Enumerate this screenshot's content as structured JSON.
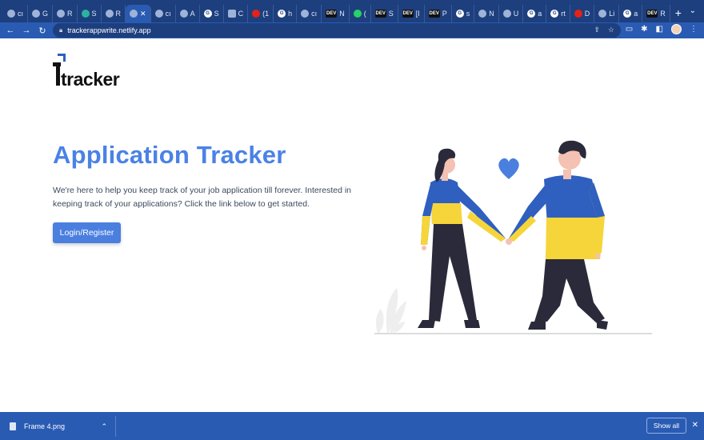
{
  "browser": {
    "tabs": [
      {
        "label": "cı",
        "icon": "github-icon"
      },
      {
        "label": "G",
        "icon": "figure-icon"
      },
      {
        "label": "R",
        "icon": "react-icon"
      },
      {
        "label": "S",
        "icon": "diamond-icon"
      },
      {
        "label": "R",
        "icon": "react-icon"
      },
      {
        "label": "✕",
        "icon": "react-icon",
        "active": true
      },
      {
        "label": "cı",
        "icon": "github-icon"
      },
      {
        "label": "A",
        "icon": "toggle-icon"
      },
      {
        "label": "S",
        "icon": "google-icon"
      },
      {
        "label": "C",
        "icon": "api-icon"
      },
      {
        "label": "(1",
        "icon": "youtube-icon"
      },
      {
        "label": "h",
        "icon": "google-icon"
      },
      {
        "label": "cı",
        "icon": "github-icon"
      },
      {
        "label": "N",
        "icon": "dev-icon"
      },
      {
        "label": "(",
        "icon": "whatsapp-icon"
      },
      {
        "label": "S",
        "icon": "dev-icon"
      },
      {
        "label": "[I",
        "icon": "dev-icon"
      },
      {
        "label": "P",
        "icon": "dev-icon"
      },
      {
        "label": "s",
        "icon": "google-icon"
      },
      {
        "label": "N",
        "icon": "github-icon"
      },
      {
        "label": "U",
        "icon": "figma-icon"
      },
      {
        "label": "a",
        "icon": "google-icon"
      },
      {
        "label": "rt",
        "icon": "google-icon"
      },
      {
        "label": "D",
        "icon": "record-icon"
      },
      {
        "label": "Li",
        "icon": "linkedin-icon"
      },
      {
        "label": "a",
        "icon": "google-icon"
      },
      {
        "label": "R",
        "icon": "dev-icon"
      }
    ],
    "new_tab": "+",
    "url": "trackerappwrite.netlify.app"
  },
  "page": {
    "logo_text": "tracker",
    "title": "Application Tracker",
    "description": "We're here to help you keep track of your job application till forever. Interested in keeping track of your applications? Click the link below to get started.",
    "cta_label": "Login/Register"
  },
  "download_bar": {
    "file_name": "Frame 4.png",
    "show_all": "Show all"
  },
  "colors": {
    "accent": "#4a82e6",
    "chrome": "#2a5bb3",
    "ukraine_blue": "#2f5fbf",
    "ukraine_yellow": "#f6d53a"
  }
}
